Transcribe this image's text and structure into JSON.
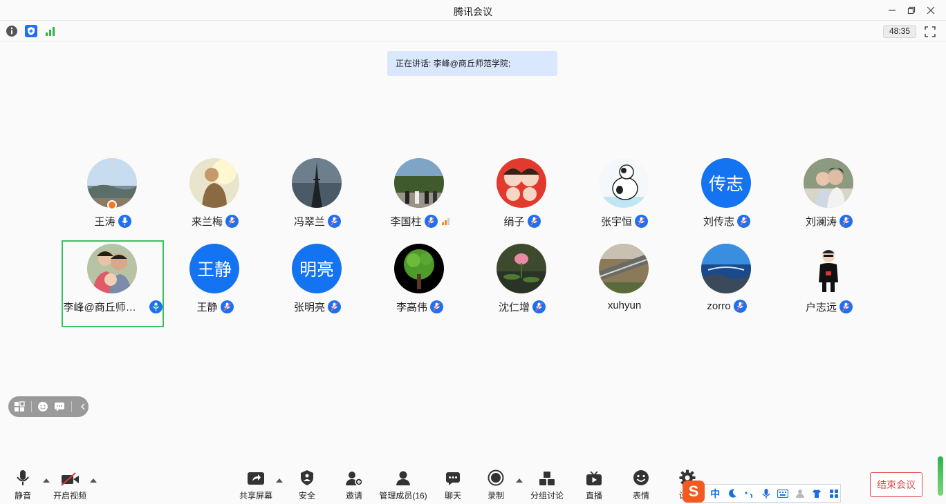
{
  "window": {
    "title": "腾讯会议"
  },
  "infobar": {
    "timer": "48:35"
  },
  "banner": {
    "speaking": "正在讲话: 李峰@商丘师范学院;"
  },
  "participants": [
    {
      "name": "王涛",
      "avatar": "photo",
      "host": true,
      "mic": "on"
    },
    {
      "name": "来兰梅",
      "avatar": "photo",
      "mic": "muted"
    },
    {
      "name": "冯翠兰",
      "avatar": "photo",
      "mic": "muted"
    },
    {
      "name": "李国柱",
      "avatar": "photo",
      "mic": "muted",
      "signal": true
    },
    {
      "name": "绢子",
      "avatar": "photo",
      "mic": "muted"
    },
    {
      "name": "张宇恒",
      "avatar": "photo",
      "mic": "muted"
    },
    {
      "name": "刘传志",
      "avatar_text": "传志",
      "mic": "muted"
    },
    {
      "name": "刘澜涛",
      "avatar": "photo",
      "mic": "muted"
    },
    {
      "name": "李峰@商丘师范学院",
      "avatar": "photo",
      "mic": "speaking",
      "active": true
    },
    {
      "name": "王静",
      "avatar_text": "王静",
      "mic": "muted"
    },
    {
      "name": "张明亮",
      "avatar_text": "明亮",
      "mic": "muted"
    },
    {
      "name": "李高伟",
      "avatar": "photo",
      "mic": "muted"
    },
    {
      "name": "沈仁增",
      "avatar": "photo",
      "mic": "muted"
    },
    {
      "name": "xuhyun",
      "avatar": "photo",
      "mic": "none"
    },
    {
      "name": "zorro",
      "avatar": "photo",
      "mic": "muted"
    },
    {
      "name": "户志远",
      "avatar": "photo",
      "mic": "muted"
    }
  ],
  "toolbar": {
    "mute": "静音",
    "video": "开启视频",
    "share": "共享屏幕",
    "security": "安全",
    "invite": "邀请",
    "members": "管理成员(16)",
    "chat": "聊天",
    "record": "录制",
    "breakout": "分组讨论",
    "live": "直播",
    "reactions": "表情",
    "settings": "设置",
    "end": "结束会议"
  },
  "ime": {
    "lang": "中"
  },
  "colors": {
    "accent": "#1f6ff1",
    "speaking_border": "#3cc061",
    "end": "#e04b4b",
    "banner": "#d9e8fc"
  }
}
